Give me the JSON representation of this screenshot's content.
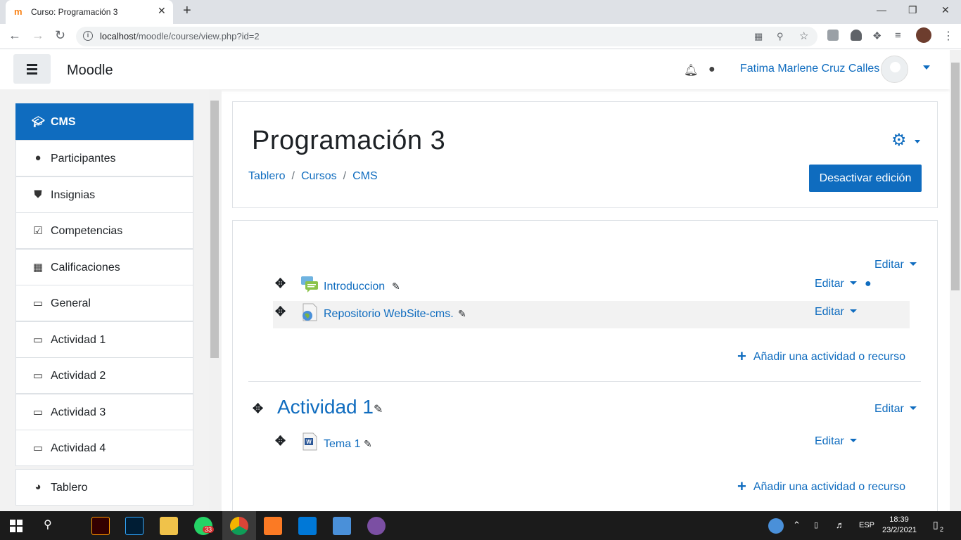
{
  "browser": {
    "tab_title": "Curso: Programación 3",
    "tab_close": "✕",
    "new_tab": "+",
    "url_host": "localhost",
    "url_path": "/moodle/course/view.php?id=2"
  },
  "header": {
    "brand": "Moodle",
    "user_name": "Fatima Marlene Cruz Calles"
  },
  "drawer": {
    "items": [
      {
        "label": "CMS",
        "icon": "graduation-cap-icon",
        "active": true
      },
      {
        "label": "Participantes",
        "icon": "users-icon"
      },
      {
        "label": "Insignias",
        "icon": "shield-icon"
      },
      {
        "label": "Competencias",
        "icon": "check-square-icon"
      },
      {
        "label": "Calificaciones",
        "icon": "table-icon"
      },
      {
        "label": "General",
        "icon": "folder-icon"
      },
      {
        "label": "Actividad 1",
        "icon": "folder-icon"
      },
      {
        "label": "Actividad 2",
        "icon": "folder-icon"
      },
      {
        "label": "Actividad 3",
        "icon": "folder-icon"
      },
      {
        "label": "Actividad 4",
        "icon": "folder-icon"
      },
      {
        "label": "Tablero",
        "icon": "dashboard-icon"
      }
    ]
  },
  "course": {
    "title": "Programación 3",
    "breadcrumb": [
      "Tablero",
      "Cursos",
      "CMS"
    ],
    "edit_toggle": "Desactivar edición"
  },
  "content": {
    "edit_label": "Editar",
    "add_activity": "Añadir una actividad o recurso",
    "general_activities": [
      {
        "name": "Introduccion",
        "type": "forum-icon"
      },
      {
        "name": "Repositorio WebSite-cms.",
        "type": "url-icon"
      }
    ],
    "section_title": "Actividad 1",
    "section_activities": [
      {
        "name": "Tema 1",
        "type": "word-document-icon"
      }
    ]
  },
  "taskbar": {
    "whatsapp_badge": "33",
    "language": "ESP",
    "time": "18:39",
    "date": "23/2/2021",
    "notifications": "2"
  }
}
